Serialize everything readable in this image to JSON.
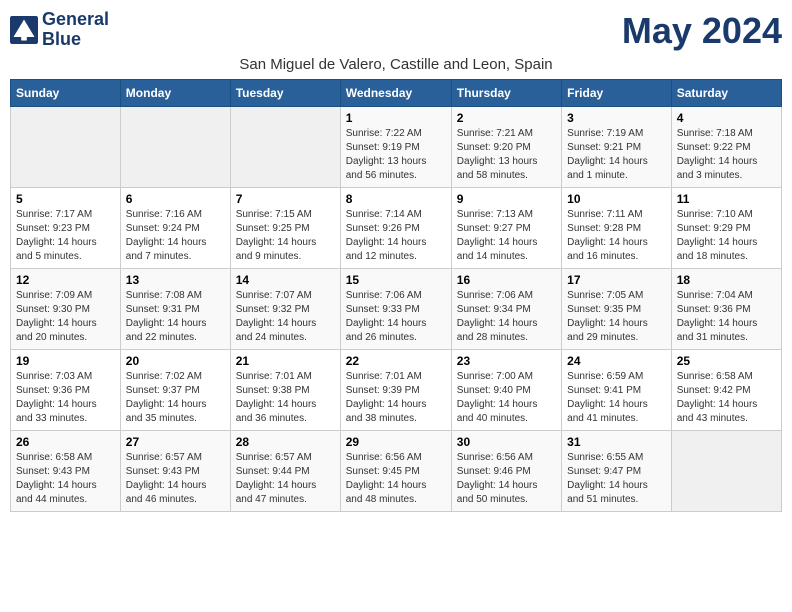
{
  "header": {
    "logo_line1": "General",
    "logo_line2": "Blue",
    "month_year": "May 2024",
    "location": "San Miguel de Valero, Castille and Leon, Spain"
  },
  "days_of_week": [
    "Sunday",
    "Monday",
    "Tuesday",
    "Wednesday",
    "Thursday",
    "Friday",
    "Saturday"
  ],
  "weeks": [
    [
      {
        "day": "",
        "info": ""
      },
      {
        "day": "",
        "info": ""
      },
      {
        "day": "",
        "info": ""
      },
      {
        "day": "1",
        "info": "Sunrise: 7:22 AM\nSunset: 9:19 PM\nDaylight: 13 hours and 56 minutes."
      },
      {
        "day": "2",
        "info": "Sunrise: 7:21 AM\nSunset: 9:20 PM\nDaylight: 13 hours and 58 minutes."
      },
      {
        "day": "3",
        "info": "Sunrise: 7:19 AM\nSunset: 9:21 PM\nDaylight: 14 hours and 1 minute."
      },
      {
        "day": "4",
        "info": "Sunrise: 7:18 AM\nSunset: 9:22 PM\nDaylight: 14 hours and 3 minutes."
      }
    ],
    [
      {
        "day": "5",
        "info": "Sunrise: 7:17 AM\nSunset: 9:23 PM\nDaylight: 14 hours and 5 minutes."
      },
      {
        "day": "6",
        "info": "Sunrise: 7:16 AM\nSunset: 9:24 PM\nDaylight: 14 hours and 7 minutes."
      },
      {
        "day": "7",
        "info": "Sunrise: 7:15 AM\nSunset: 9:25 PM\nDaylight: 14 hours and 9 minutes."
      },
      {
        "day": "8",
        "info": "Sunrise: 7:14 AM\nSunset: 9:26 PM\nDaylight: 14 hours and 12 minutes."
      },
      {
        "day": "9",
        "info": "Sunrise: 7:13 AM\nSunset: 9:27 PM\nDaylight: 14 hours and 14 minutes."
      },
      {
        "day": "10",
        "info": "Sunrise: 7:11 AM\nSunset: 9:28 PM\nDaylight: 14 hours and 16 minutes."
      },
      {
        "day": "11",
        "info": "Sunrise: 7:10 AM\nSunset: 9:29 PM\nDaylight: 14 hours and 18 minutes."
      }
    ],
    [
      {
        "day": "12",
        "info": "Sunrise: 7:09 AM\nSunset: 9:30 PM\nDaylight: 14 hours and 20 minutes."
      },
      {
        "day": "13",
        "info": "Sunrise: 7:08 AM\nSunset: 9:31 PM\nDaylight: 14 hours and 22 minutes."
      },
      {
        "day": "14",
        "info": "Sunrise: 7:07 AM\nSunset: 9:32 PM\nDaylight: 14 hours and 24 minutes."
      },
      {
        "day": "15",
        "info": "Sunrise: 7:06 AM\nSunset: 9:33 PM\nDaylight: 14 hours and 26 minutes."
      },
      {
        "day": "16",
        "info": "Sunrise: 7:06 AM\nSunset: 9:34 PM\nDaylight: 14 hours and 28 minutes."
      },
      {
        "day": "17",
        "info": "Sunrise: 7:05 AM\nSunset: 9:35 PM\nDaylight: 14 hours and 29 minutes."
      },
      {
        "day": "18",
        "info": "Sunrise: 7:04 AM\nSunset: 9:36 PM\nDaylight: 14 hours and 31 minutes."
      }
    ],
    [
      {
        "day": "19",
        "info": "Sunrise: 7:03 AM\nSunset: 9:36 PM\nDaylight: 14 hours and 33 minutes."
      },
      {
        "day": "20",
        "info": "Sunrise: 7:02 AM\nSunset: 9:37 PM\nDaylight: 14 hours and 35 minutes."
      },
      {
        "day": "21",
        "info": "Sunrise: 7:01 AM\nSunset: 9:38 PM\nDaylight: 14 hours and 36 minutes."
      },
      {
        "day": "22",
        "info": "Sunrise: 7:01 AM\nSunset: 9:39 PM\nDaylight: 14 hours and 38 minutes."
      },
      {
        "day": "23",
        "info": "Sunrise: 7:00 AM\nSunset: 9:40 PM\nDaylight: 14 hours and 40 minutes."
      },
      {
        "day": "24",
        "info": "Sunrise: 6:59 AM\nSunset: 9:41 PM\nDaylight: 14 hours and 41 minutes."
      },
      {
        "day": "25",
        "info": "Sunrise: 6:58 AM\nSunset: 9:42 PM\nDaylight: 14 hours and 43 minutes."
      }
    ],
    [
      {
        "day": "26",
        "info": "Sunrise: 6:58 AM\nSunset: 9:43 PM\nDaylight: 14 hours and 44 minutes."
      },
      {
        "day": "27",
        "info": "Sunrise: 6:57 AM\nSunset: 9:43 PM\nDaylight: 14 hours and 46 minutes."
      },
      {
        "day": "28",
        "info": "Sunrise: 6:57 AM\nSunset: 9:44 PM\nDaylight: 14 hours and 47 minutes."
      },
      {
        "day": "29",
        "info": "Sunrise: 6:56 AM\nSunset: 9:45 PM\nDaylight: 14 hours and 48 minutes."
      },
      {
        "day": "30",
        "info": "Sunrise: 6:56 AM\nSunset: 9:46 PM\nDaylight: 14 hours and 50 minutes."
      },
      {
        "day": "31",
        "info": "Sunrise: 6:55 AM\nSunset: 9:47 PM\nDaylight: 14 hours and 51 minutes."
      },
      {
        "day": "",
        "info": ""
      }
    ]
  ]
}
